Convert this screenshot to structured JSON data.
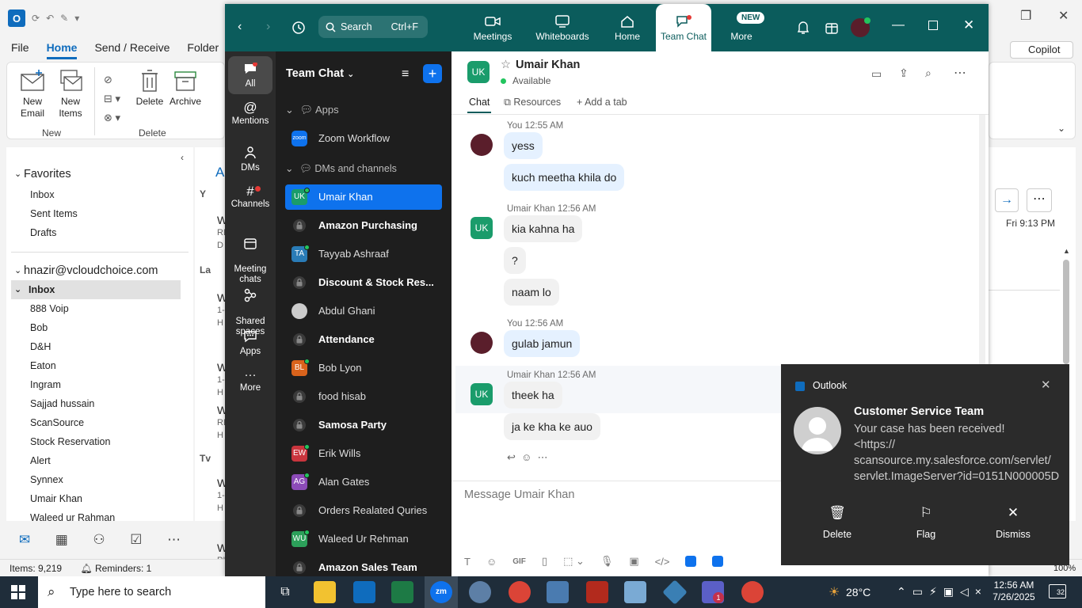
{
  "outlook": {
    "menu": [
      "File",
      "Home",
      "Send / Receive",
      "Folder"
    ],
    "ribbon": {
      "new_email": "New\nEmail",
      "new_items": "New\nItems",
      "delete": "Delete",
      "archive": "Archive",
      "group_new": "New",
      "group_delete": "Delete"
    },
    "copilot": "Copilot",
    "nav": {
      "favorites": "Favorites",
      "favorite_items": [
        "Inbox",
        "Sent Items",
        "Drafts"
      ],
      "account": "hnazir@vcloudchoice.com",
      "inbox": "Inbox",
      "folders": [
        "888 Voip",
        "Bob",
        "D&H",
        "Eaton",
        "Ingram",
        "Sajjad hussain",
        "ScanSource",
        "Stock Reservation",
        "Alert",
        "Synnex",
        "Umair Khan",
        "Waleed ur Rahman"
      ]
    },
    "list_groups": [
      "Y",
      "La",
      "Tv"
    ],
    "list_fragments": [
      "W",
      "RE",
      "D",
      "W",
      "1-",
      "H",
      "W",
      "1-",
      "H",
      "W",
      "RE",
      "H",
      "W",
      "1-",
      "H",
      "W",
      "PI"
    ],
    "list_tab": "A",
    "reading_time": "Fri 9:13 PM",
    "status_items": "Items: 9,219",
    "status_reminders": "Reminders: 1",
    "zoom_level": "100%"
  },
  "zoom": {
    "search_label": "Search",
    "search_shortcut": "Ctrl+F",
    "tabs": [
      "Meetings",
      "Whiteboards",
      "Home",
      "Team Chat",
      "More"
    ],
    "new_badge": "NEW",
    "rail": [
      "All",
      "Mentions",
      "DMs",
      "Channels",
      "Meeting\nchats",
      "Shared\nspaces",
      "Apps",
      "More"
    ],
    "list_title": "Team Chat",
    "section_apps": "Apps",
    "app_item": "Zoom Workflow",
    "app_icon_text": "zoom",
    "section_dms": "DMs and channels",
    "contacts": [
      {
        "name": "Umair Khan",
        "initials": "UK",
        "bold": false,
        "color": "#1a9c6b",
        "type": "avatar"
      },
      {
        "name": "Amazon Purchasing",
        "initials": "",
        "bold": true,
        "color": "",
        "type": "lock"
      },
      {
        "name": "Tayyab Ashraaf",
        "initials": "TA",
        "bold": false,
        "color": "#2a7cb7",
        "type": "avatar"
      },
      {
        "name": "Discount & Stock Res...",
        "initials": "",
        "bold": true,
        "color": "",
        "type": "lock"
      },
      {
        "name": "Abdul Ghani",
        "initials": "",
        "bold": false,
        "color": "#cccccc",
        "type": "photo"
      },
      {
        "name": "Attendance",
        "initials": "",
        "bold": true,
        "color": "",
        "type": "lock"
      },
      {
        "name": "Bob Lyon",
        "initials": "BL",
        "bold": false,
        "color": "#d9631c",
        "type": "avatar"
      },
      {
        "name": "food hisab",
        "initials": "",
        "bold": false,
        "color": "",
        "type": "lock"
      },
      {
        "name": "Samosa Party",
        "initials": "",
        "bold": true,
        "color": "",
        "type": "lock"
      },
      {
        "name": "Erik Wills",
        "initials": "EW",
        "bold": false,
        "color": "#c9353d",
        "type": "avatar"
      },
      {
        "name": "Alan Gates",
        "initials": "AG",
        "bold": false,
        "color": "#8c4bb8",
        "type": "avatar"
      },
      {
        "name": "Orders Realated Quries",
        "initials": "",
        "bold": false,
        "color": "",
        "type": "lock"
      },
      {
        "name": "Waleed Ur Rehman",
        "initials": "WU",
        "bold": false,
        "color": "#2ca05a",
        "type": "avatar"
      },
      {
        "name": "Amazon Sales Team",
        "initials": "",
        "bold": true,
        "color": "",
        "type": "lock"
      }
    ],
    "chat": {
      "contact_initials": "UK",
      "contact_name": "Umair Khan",
      "status": "Available",
      "tab_chat": "Chat",
      "tab_resources": "Resources",
      "tab_add": "Add a tab",
      "messages": [
        {
          "meta": "You 12:55 AM",
          "texts": [
            "yess",
            "kuch meetha khila do"
          ],
          "me": true
        },
        {
          "meta": "Umair Khan 12:56 AM",
          "texts": [
            "kia kahna ha",
            "?",
            "naam lo"
          ],
          "me": false
        },
        {
          "meta": "You 12:56 AM",
          "texts": [
            "gulab jamun"
          ],
          "me": true
        },
        {
          "meta": "Umair Khan 12:56 AM",
          "texts": [
            "theek ha",
            "ja ke kha ke auo"
          ],
          "me": false
        }
      ],
      "composer_placeholder": "Message Umair Khan",
      "gif_label": "GIF"
    }
  },
  "toast": {
    "app": "Outlook",
    "sender": "Customer Service Team",
    "line1": "Your case has been received!",
    "line2": "<https://",
    "line3": "scansource.my.salesforce.com/servlet/",
    "line4": "servlet.ImageServer?id=0151N000005D",
    "delete": "Delete",
    "flag": "Flag",
    "dismiss": "Dismiss"
  },
  "taskbar": {
    "search_placeholder": "Type here to search",
    "temperature": "28°C",
    "time": "12:56 AM",
    "date": "7/26/2025",
    "notifications": "32",
    "teams_badge": "1"
  }
}
